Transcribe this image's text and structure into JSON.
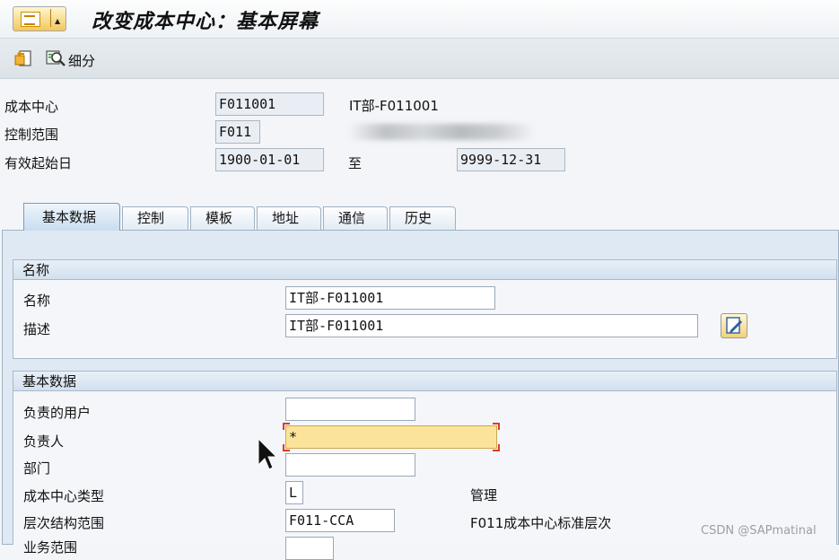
{
  "header": {
    "title": "改变成本中心：基本屏幕"
  },
  "toolbar": {
    "drilldown_label": "细分"
  },
  "fields": {
    "cost_center_label": "成本中心",
    "cost_center_value": "F011001",
    "cost_center_desc": "IT部-F011001",
    "controlling_area_label": "控制范围",
    "controlling_area_value": "F011",
    "valid_from_label": "有效起始日",
    "valid_from_value": "1900-01-01",
    "valid_to_label": "至",
    "valid_to_value": "9999-12-31"
  },
  "tabs": [
    {
      "label": "基本数据"
    },
    {
      "label": "控制"
    },
    {
      "label": "模板"
    },
    {
      "label": "地址"
    },
    {
      "label": "通信"
    },
    {
      "label": "历史"
    }
  ],
  "names_group": {
    "title": "名称",
    "name_label": "名称",
    "name_value": "IT部-F011001",
    "description_label": "描述",
    "description_value": "IT部-F011001"
  },
  "basic_group": {
    "title": "基本数据",
    "user_responsible_label": "负责的用户",
    "user_responsible_value": "",
    "person_responsible_label": "负责人",
    "person_responsible_value": "*",
    "department_label": "部门",
    "department_value": "",
    "category_label": "成本中心类型",
    "category_value": "L",
    "category_desc": "管理",
    "hierarchy_area_label": "层次结构范围",
    "hierarchy_area_value": "F011-CCA",
    "hierarchy_area_desc": "F011成本中心标准层次",
    "business_area_label": "业务范围"
  },
  "watermark": "CSDN @SAPmatinal",
  "colors": {
    "required_field": "#fbe49a",
    "active_tab": "#c9ddf0",
    "panel_bg": "#dfe9f4"
  }
}
